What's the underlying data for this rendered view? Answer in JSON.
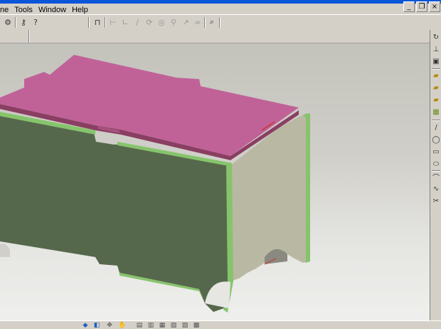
{
  "menubar": {
    "items": [
      {
        "label": "ne"
      },
      {
        "label": "Tools"
      },
      {
        "label": "Window"
      },
      {
        "label": "Help"
      }
    ]
  },
  "window_controls": {
    "minimize": "_",
    "restore": "❐",
    "close": "×"
  },
  "toolbar": {
    "buttons": [
      {
        "icon": "gear-icon",
        "glyph": "⚙"
      },
      {
        "icon": "key-icon",
        "glyph": "⚷"
      },
      {
        "icon": "help-pointer-icon",
        "glyph": "?"
      },
      {
        "icon": "measure-icon",
        "glyph": "⊓"
      },
      {
        "icon": "dimension-icon",
        "glyph": "⊢"
      },
      {
        "icon": "angle-icon",
        "glyph": "∟"
      },
      {
        "icon": "line-icon",
        "glyph": "∕"
      },
      {
        "icon": "rotate-icon",
        "glyph": "⟳"
      },
      {
        "icon": "target-icon",
        "glyph": "◎"
      },
      {
        "icon": "pin-icon",
        "glyph": "⚲"
      },
      {
        "icon": "arrow-icon",
        "glyph": "↗"
      },
      {
        "icon": "link-icon",
        "glyph": "∞"
      },
      {
        "icon": "zoom-icon",
        "glyph": "⌕"
      }
    ]
  },
  "right_toolbar": {
    "buttons": [
      {
        "icon": "sketch-icon",
        "glyph": "↻"
      },
      {
        "icon": "axis-icon",
        "glyph": "⊥"
      },
      {
        "icon": "box-icon",
        "glyph": "▣"
      },
      {
        "icon": "extrude-icon",
        "glyph": "▰"
      },
      {
        "icon": "pocket-icon",
        "glyph": "▰"
      },
      {
        "icon": "revolve-icon",
        "glyph": "▰"
      },
      {
        "icon": "pattern-icon",
        "glyph": "▦"
      },
      {
        "icon": "line-tool-icon",
        "glyph": "∕"
      },
      {
        "icon": "circle-tool-icon",
        "glyph": "◯"
      },
      {
        "icon": "rectangle-tool-icon",
        "glyph": "▭"
      },
      {
        "icon": "ellipse-tool-icon",
        "glyph": "⬭"
      },
      {
        "icon": "arc-tool-icon",
        "glyph": "⌒"
      },
      {
        "icon": "spline-tool-icon",
        "glyph": "∿"
      },
      {
        "icon": "trim-tool-icon",
        "glyph": "✂"
      }
    ]
  },
  "bottom_toolbar": {
    "buttons": [
      {
        "icon": "view-iso-icon",
        "glyph": "◆"
      },
      {
        "icon": "view-front-icon",
        "glyph": "◧"
      },
      {
        "icon": "orbit-icon",
        "glyph": "✥"
      },
      {
        "icon": "pan-icon",
        "glyph": "✋"
      },
      {
        "icon": "render-icon-1",
        "glyph": "▤"
      },
      {
        "icon": "render-icon-2",
        "glyph": "▥"
      },
      {
        "icon": "render-icon-3",
        "glyph": "▦"
      },
      {
        "icon": "render-icon-4",
        "glyph": "▧"
      },
      {
        "icon": "render-icon-5",
        "glyph": "▨"
      },
      {
        "icon": "render-icon-6",
        "glyph": "▩"
      }
    ]
  },
  "model": {
    "front_panel_color": "#56684b",
    "end_panel_color": "#b9b8a3",
    "lid_top_color": "#c06298",
    "lid_edge_color": "#8a3e62",
    "edge_highlight_color": "#86c46c",
    "background_top": "#c3c2bb",
    "background_bottom": "#efefed"
  }
}
